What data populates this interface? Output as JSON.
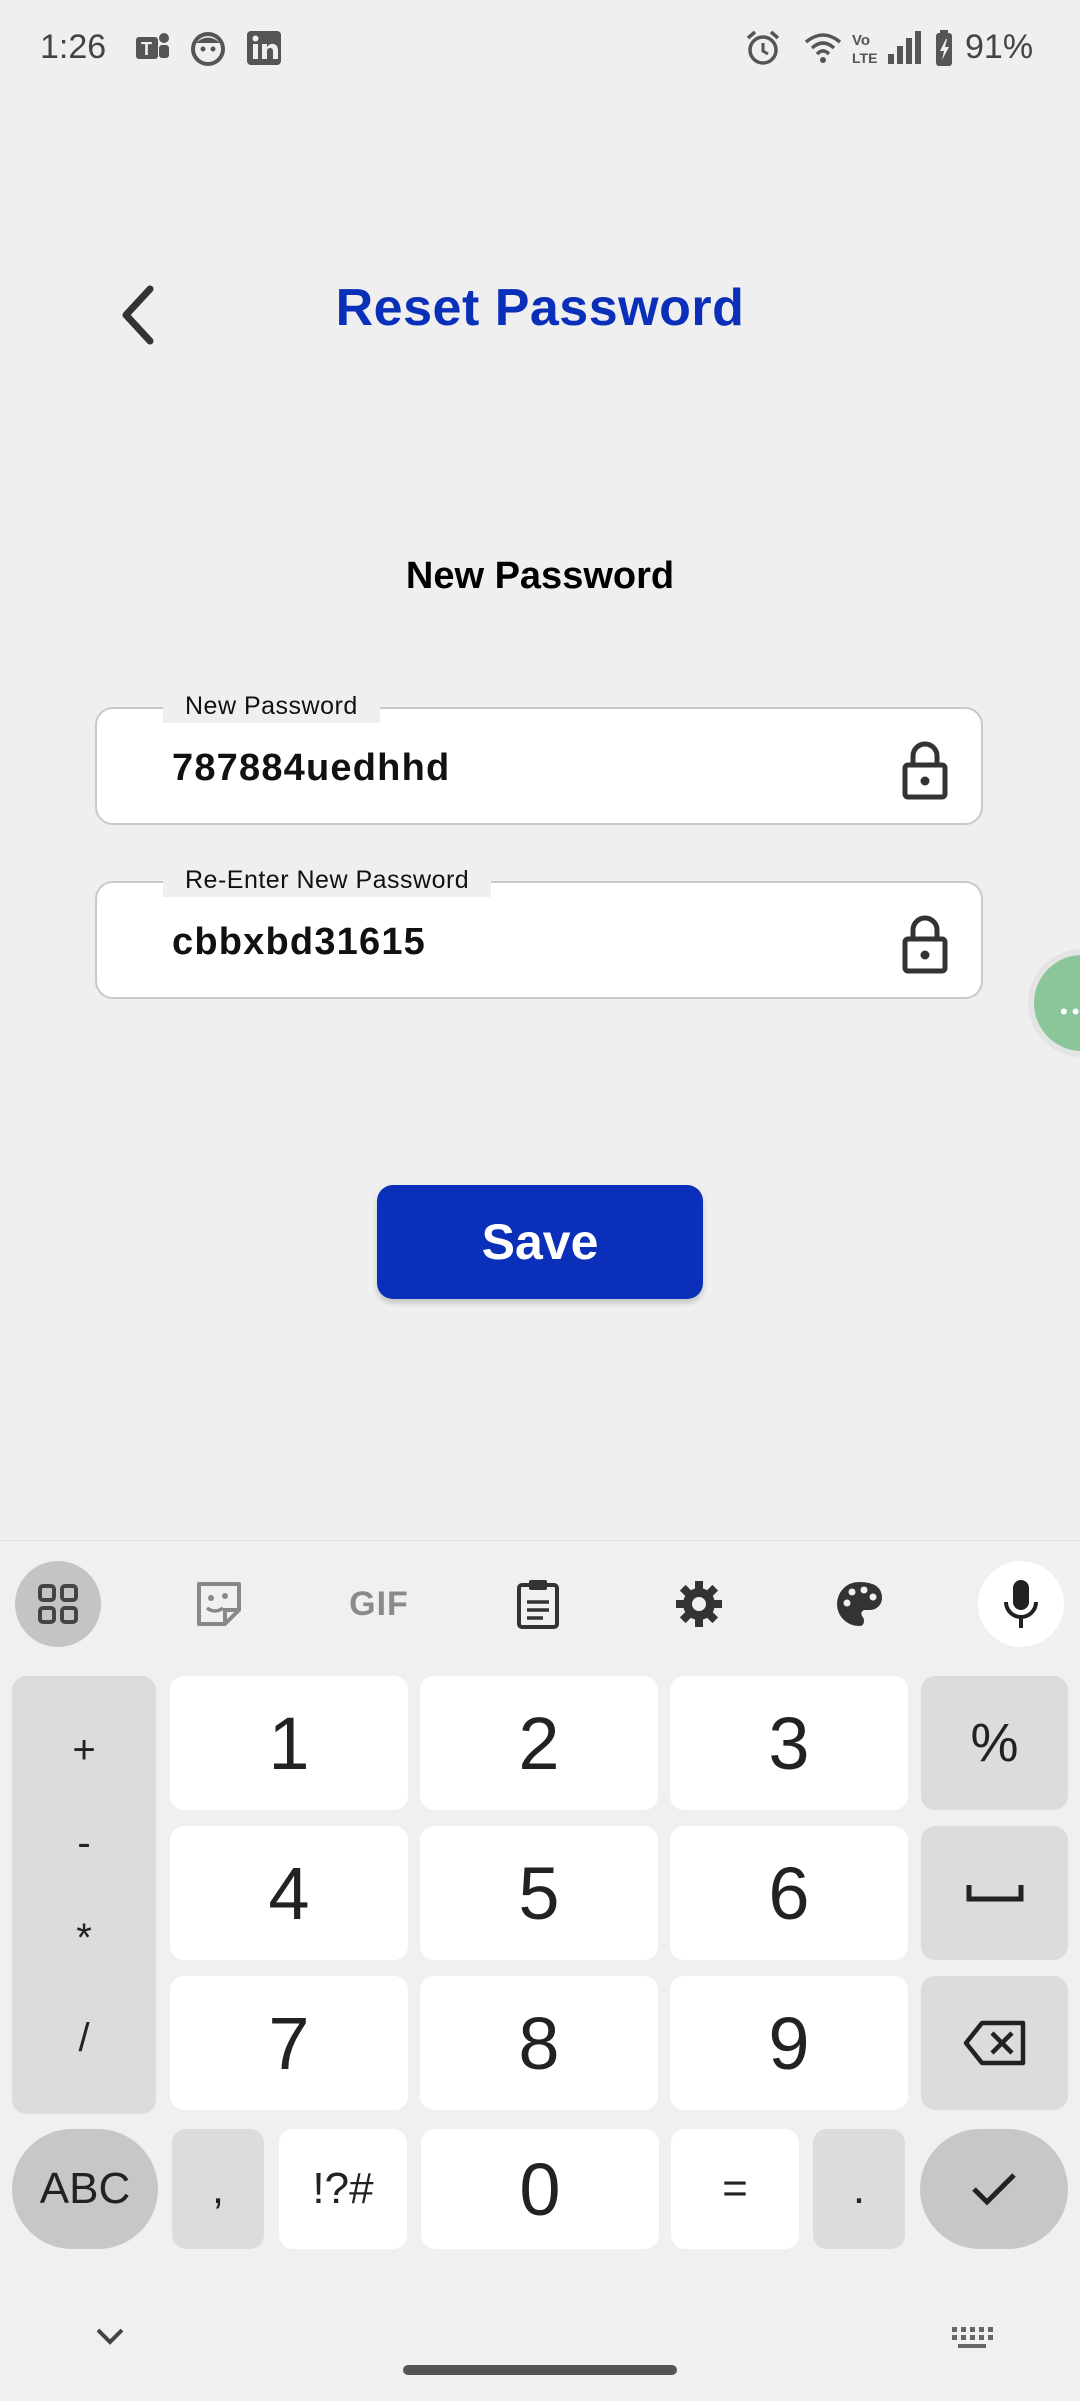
{
  "status_bar": {
    "time": "1:26",
    "battery": "91%",
    "icons": [
      "teams-icon",
      "face-app-icon",
      "linkedin-icon",
      "alarm-icon",
      "wifi-icon",
      "volte-icon",
      "signal-icon",
      "battery-icon"
    ]
  },
  "header": {
    "title": "Reset Password",
    "back_icon": "chevron-left-icon"
  },
  "section_title": "New Password",
  "fields": [
    {
      "label": "New Password",
      "value": "787884uedhhd",
      "icon": "lock-icon"
    },
    {
      "label": "Re-Enter New Password",
      "value": "cbbxbd31615",
      "icon": "lock-icon"
    }
  ],
  "save_label": "Save",
  "keyboard": {
    "toolbar": [
      "apps-grid-icon",
      "sticker-icon",
      "GIF",
      "clipboard-icon",
      "settings-icon",
      "palette-icon",
      "mic-icon"
    ],
    "gif_label": "GIF",
    "ops": [
      "+",
      "-",
      "*",
      "/"
    ],
    "rows": [
      [
        "1",
        "2",
        "3",
        "%"
      ],
      [
        "4",
        "5",
        "6",
        "space"
      ],
      [
        "7",
        "8",
        "9",
        "backspace"
      ]
    ],
    "bottom": {
      "abc": "ABC",
      "comma": ",",
      "symbols": "!?#",
      "zero": "0",
      "equals": "=",
      "period": ".",
      "enter": "check-icon"
    }
  },
  "colors": {
    "accent": "#0a2fb8",
    "background": "#efefef",
    "fab": "#8bc59a"
  }
}
